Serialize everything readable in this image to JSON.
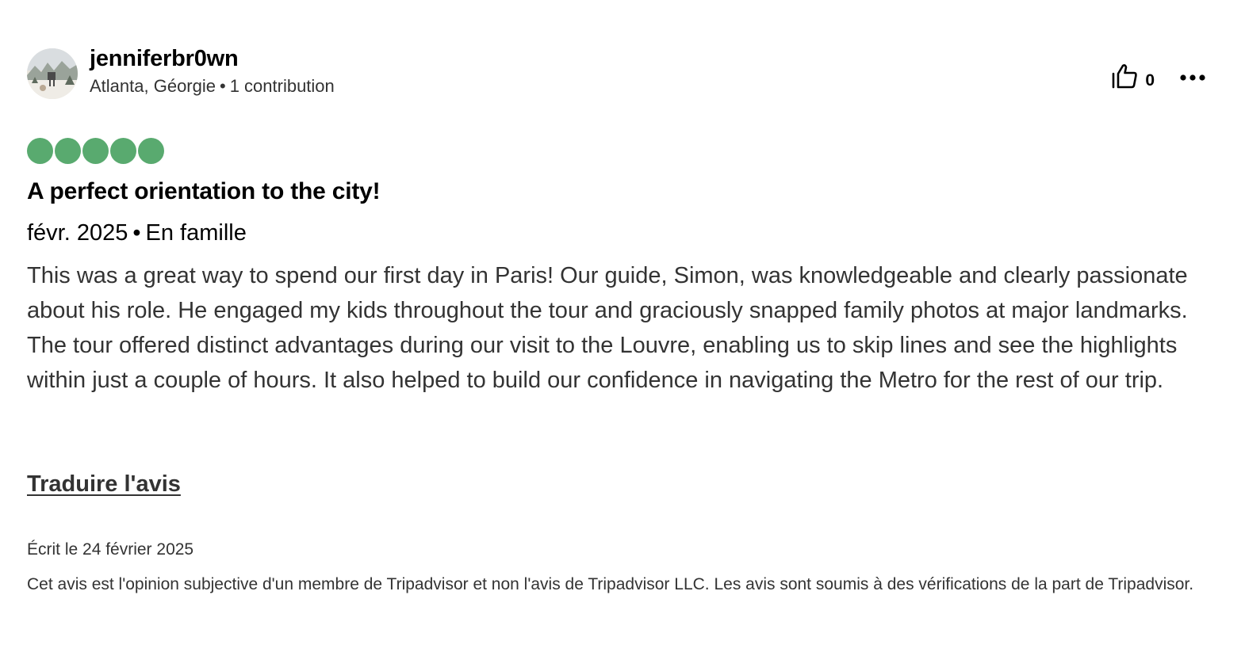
{
  "reviewer": {
    "username": "jenniferbr0wn",
    "location": "Atlanta, Géorgie",
    "separator": "•",
    "contributions": "1 contribution",
    "avatar_icon": "profile-photo-winter-scene"
  },
  "actions": {
    "helpful_icon": "thumbs-up-icon",
    "helpful_count": "0",
    "more_icon": "more-options-icon"
  },
  "rating": {
    "value": 5,
    "max": 5,
    "color": "#59aa6f"
  },
  "review": {
    "title": "A perfect orientation to the city!",
    "date": "févr. 2025",
    "separator": "•",
    "trip_type": "En famille",
    "body": "This was a great way to spend our first day in Paris! Our guide, Simon, was knowledgeable and clearly passionate about his role. He engaged my kids throughout the tour and graciously snapped family photos at major landmarks. The tour offered distinct advantages during our visit to the Louvre, enabling us to skip lines and see the highlights within just a couple of hours. It also helped to build our confidence in navigating the Metro for the rest of our trip.",
    "translate_label": "Traduire l'avis",
    "written_date": "Écrit le 24 février 2025",
    "disclaimer": "Cet avis est l'opinion subjective d'un membre de Tripadvisor et non l'avis de Tripadvisor LLC. Les avis sont soumis à des vérifications de la part de Tripadvisor."
  }
}
